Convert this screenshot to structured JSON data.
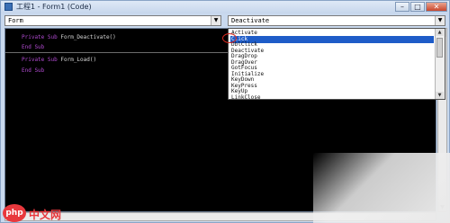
{
  "window": {
    "title": "工程1 - Form1 (Code)",
    "buttons": {
      "minimize": "–",
      "maximize": "□",
      "close": "✕"
    }
  },
  "toolbar": {
    "object_combo": {
      "value": "Form",
      "arrow": "▼"
    },
    "proc_combo": {
      "value": "Deactivate",
      "arrow": "▼"
    }
  },
  "code": {
    "line1_kw": "Private Sub",
    "line1_name": "Form_Deactivate()",
    "line2": "End Sub",
    "line3_kw": "Private Sub",
    "line3_name": "Form_Load()",
    "line4": "End Sub"
  },
  "dropdown": {
    "items": [
      "Activate",
      "Click",
      "DblClick",
      "Deactivate",
      "DragDrop",
      "DragOver",
      "GotFocus",
      "Initialize",
      "KeyDown",
      "KeyPress",
      "KeyUp",
      "LinkClose"
    ],
    "selected_index": 1
  },
  "watermark": {
    "logo": "php",
    "text": "中文网"
  },
  "colors": {
    "keyword": "#b04ad0",
    "selection": "#1e5cc8",
    "highlight_circle": "#d7291f",
    "editor_bg": "#000000"
  }
}
